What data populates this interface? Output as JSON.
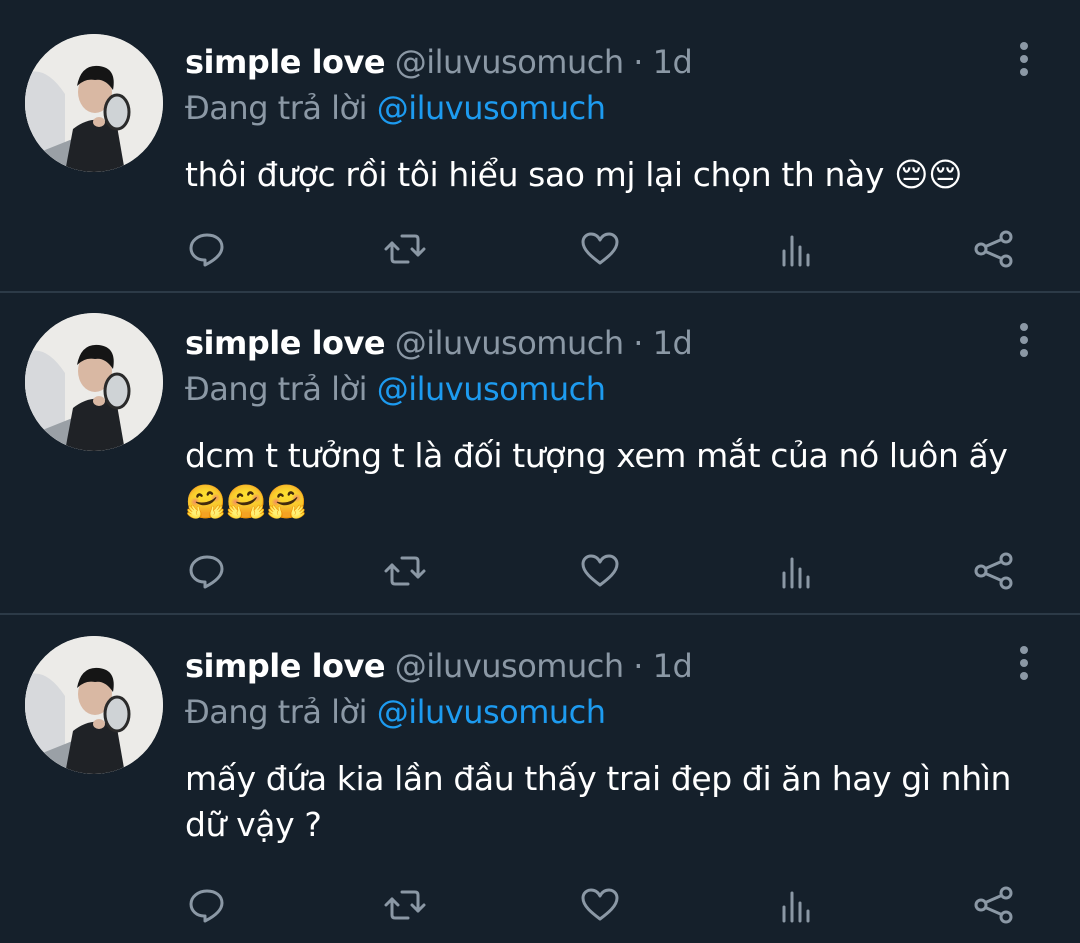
{
  "tweets": [
    {
      "name": "simple love",
      "handle": "@iluvusomuch",
      "separator": "·",
      "time": "1d",
      "reply_prefix": "Đang trả lời",
      "reply_to": "@iluvusomuch",
      "text": "thôi được rồi tôi hiểu sao mj lại chọn th này 😔😔"
    },
    {
      "name": "simple love",
      "handle": "@iluvusomuch",
      "separator": "·",
      "time": "1d",
      "reply_prefix": "Đang trả lời",
      "reply_to": "@iluvusomuch",
      "text": "dcm t tưởng t là đối tượng xem mắt của nó luôn ấy 🤗🤗🤗"
    },
    {
      "name": "simple love",
      "handle": "@iluvusomuch",
      "separator": "·",
      "time": "1d",
      "reply_prefix": "Đang trả lời",
      "reply_to": "@iluvusomuch",
      "text": "mấy đứa kia lần đầu thấy trai đẹp đi ăn hay gì nhìn dữ vậy ?"
    }
  ],
  "icons": [
    "reply-icon",
    "retweet-icon",
    "like-icon",
    "analytics-icon",
    "share-icon",
    "more-options-icon"
  ],
  "colors": {
    "background": "#15202b",
    "divider": "#2c3a47",
    "muted": "#8b98a5",
    "mention": "#1d9bf0",
    "text": "#ffffff"
  }
}
